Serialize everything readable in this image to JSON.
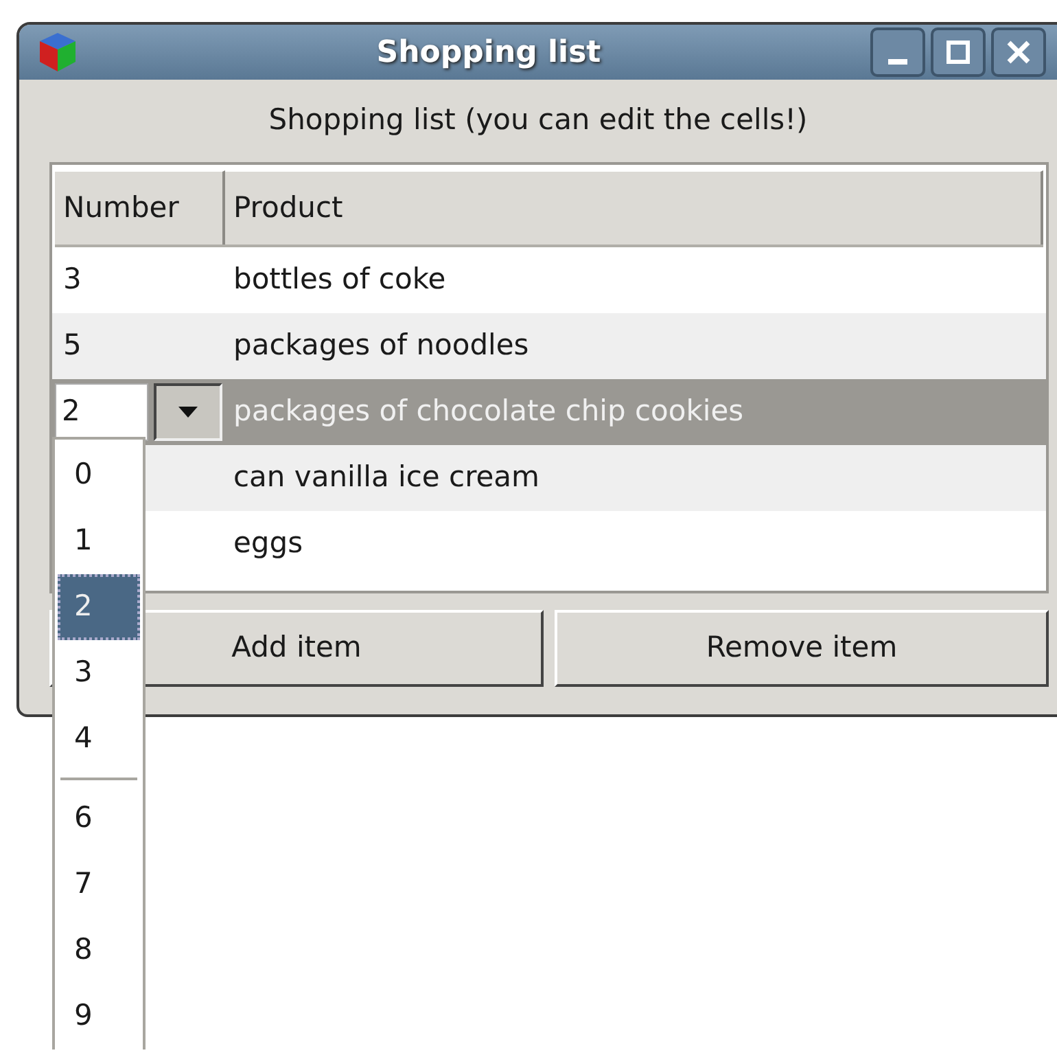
{
  "window": {
    "title": "Shopping list"
  },
  "label": "Shopping list (you can edit the cells!)",
  "table": {
    "columns": [
      "Number",
      "Product"
    ],
    "rows": [
      {
        "number": "3",
        "product": "bottles of coke",
        "selected": false
      },
      {
        "number": "5",
        "product": "packages of noodles",
        "selected": false
      },
      {
        "number": "2",
        "product": "packages of chocolate chip cookies",
        "selected": true
      },
      {
        "product": "can vanilla ice cream",
        "selected": false
      },
      {
        "product": "eggs",
        "selected": false
      }
    ]
  },
  "buttons": [
    "Add item",
    "Remove item"
  ],
  "dropdown": {
    "items": [
      {
        "kind": "item",
        "label": "0",
        "selected": false
      },
      {
        "kind": "item",
        "label": "1",
        "selected": false
      },
      {
        "kind": "item",
        "label": "2",
        "selected": true
      },
      {
        "kind": "item",
        "label": "3",
        "selected": false
      },
      {
        "kind": "item",
        "label": "4",
        "selected": false
      },
      {
        "kind": "separator"
      },
      {
        "kind": "item",
        "label": "6",
        "selected": false
      },
      {
        "kind": "item",
        "label": "7",
        "selected": false
      },
      {
        "kind": "item",
        "label": "8",
        "selected": false
      },
      {
        "kind": "item",
        "label": "9",
        "selected": false
      }
    ]
  }
}
